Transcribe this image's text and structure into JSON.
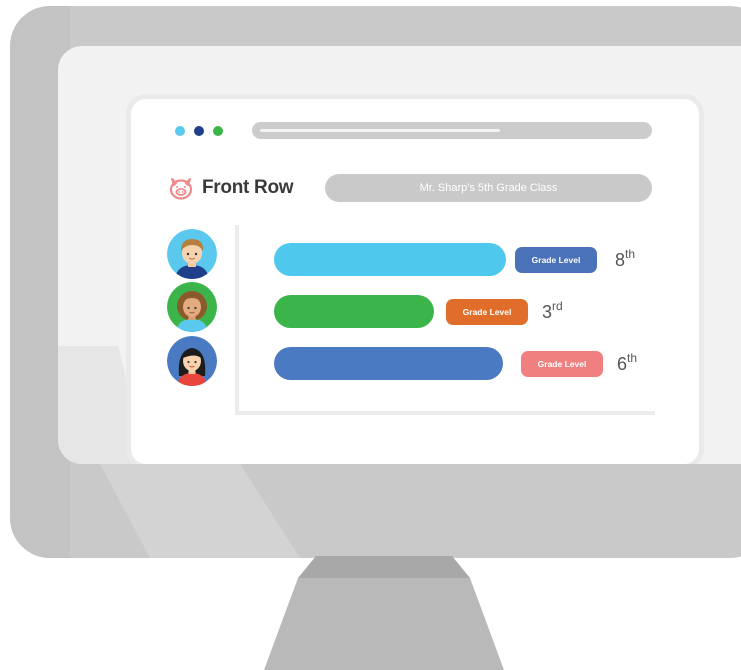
{
  "app": {
    "name": "Front Row",
    "logo_icon": "pig-icon"
  },
  "window": {
    "dots": [
      "#5bc8ee",
      "#1f3f8a",
      "#3ab54a"
    ]
  },
  "class_name": "Mr. Sharp's 5th Grade Class",
  "students": [
    {
      "avatar": "boy-avatar",
      "bar_color": "#4fc8ee",
      "progress": 0.8,
      "badge_label": "Grade Level",
      "badge_color": "#4a72b8",
      "grade_number": "8",
      "grade_suffix": "th"
    },
    {
      "avatar": "girl-curly-avatar",
      "bar_color": "#3bb54a",
      "progress": 0.55,
      "badge_label": "Grade Level",
      "badge_color": "#e06e2a",
      "grade_number": "3",
      "grade_suffix": "rd"
    },
    {
      "avatar": "girl-dark-hair-avatar",
      "bar_color": "#4a7ac2",
      "progress": 0.79,
      "badge_label": "Grade Level",
      "badge_color": "#f08080",
      "grade_number": "6",
      "grade_suffix": "th"
    }
  ]
}
